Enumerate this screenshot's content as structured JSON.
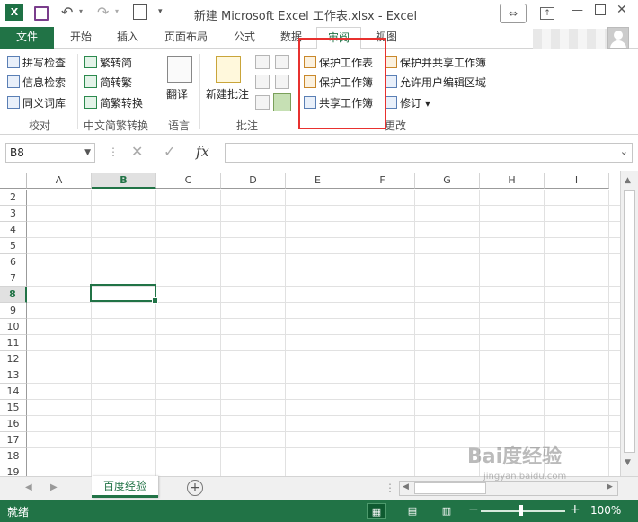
{
  "window": {
    "title": "新建 Microsoft Excel 工作表.xlsx - Excel",
    "logo": "X",
    "restore_label": "⇔",
    "ribbon_options_label": "↑",
    "minimize_label": "—",
    "close_label": "✕"
  },
  "tabs": {
    "file": "文件",
    "items": [
      "开始",
      "插入",
      "页面布局",
      "公式",
      "数据",
      "审阅",
      "视图"
    ],
    "active": "审阅"
  },
  "ribbon": {
    "proofing": {
      "spell_check": "拼写检查",
      "research": "信息检索",
      "thesaurus": "同义词库",
      "label": "校对"
    },
    "chinese_conversion": {
      "to_traditional": "繁转简",
      "to_simplified": "简转繁",
      "convert": "简繁转换",
      "label": "中文简繁转换"
    },
    "language": {
      "translate": "翻译",
      "label": "语言"
    },
    "comments": {
      "new_comment": "新建批注",
      "label": "批注"
    },
    "changes": {
      "protect_sheet": "保护工作表",
      "protect_workbook": "保护工作簿",
      "share_workbook": "共享工作簿",
      "protect_and_share": "保护并共享工作簿",
      "allow_edit_ranges": "允许用户编辑区域",
      "track_changes": "修订",
      "label": "更改"
    }
  },
  "formula_bar": {
    "name_box": "B8",
    "fx": "fx",
    "content": ""
  },
  "grid": {
    "columns": [
      "A",
      "B",
      "C",
      "D",
      "E",
      "F",
      "G",
      "H",
      "I"
    ],
    "selected_column": "B",
    "rows": [
      "2",
      "3",
      "4",
      "5",
      "6",
      "7",
      "8",
      "9",
      "10",
      "11",
      "12",
      "13",
      "14",
      "15",
      "16",
      "17",
      "18",
      "19"
    ],
    "selected_row": "8",
    "active_cell": "B8"
  },
  "sheets": {
    "tabs": [
      "百度经验"
    ],
    "active": "百度经验",
    "add_label": "+",
    "more_label": "⋮"
  },
  "status": {
    "text": "就绪",
    "zoom": "100%",
    "zoom_minus": "−",
    "zoom_plus": "+"
  },
  "watermark": {
    "brand": "Bai度经验",
    "url": "jingyan.baidu.com"
  },
  "colors": {
    "accent": "#217346",
    "highlight_box": "#e8312f"
  }
}
